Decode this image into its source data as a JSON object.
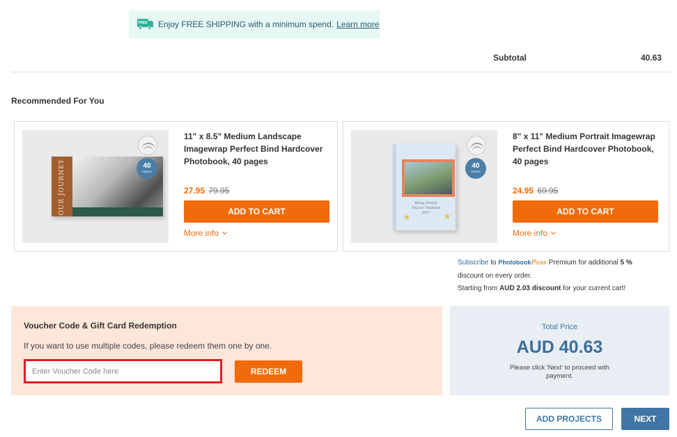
{
  "shipping_banner": {
    "icon": "free-shipping-truck-icon",
    "icon_label": "FREE",
    "text": "Enjoy FREE SHIPPING with a minimum spend.",
    "link": "Learn more"
  },
  "summary": {
    "subtotal_label": "Subtotal",
    "subtotal_value": "40.63"
  },
  "recommended": {
    "title": "Recommended For You",
    "products": [
      {
        "title": "11\" x 8.5\" Medium Landscape Imagewrap Perfect Bind Hardcover Photobook, 40 pages",
        "price": "27.95",
        "old_price": "79.95",
        "add_label": "ADD TO CART",
        "more_info": "More info",
        "badge_number": "40",
        "badge_label": "PAGES",
        "cover_text": "OUR JOURNEY"
      },
      {
        "title": "8\" x 11\" Medium Portrait Imagewrap Perfect Bind Hardcover Photobook, 40 pages",
        "price": "24.95",
        "old_price": "69.95",
        "add_label": "ADD TO CART",
        "more_info": "More info",
        "badge_number": "40",
        "badge_label": "PAGES",
        "cover_line1": "Wong Family",
        "cover_line2": "Trip to Thailand",
        "cover_line3": "2017"
      }
    ]
  },
  "subscription": {
    "subscribe": "Subscribe",
    "to": "to",
    "brand": "Photobook",
    "brand_pass": "Pass",
    "premium_text": "Premium for additional",
    "percent": "5 %",
    "discount_text": "discount on every order.",
    "starting_from": "Starting from",
    "discount_amount": "AUD 2.03 discount",
    "cart_text": "for your current cart!"
  },
  "voucher": {
    "title": "Voucher Code & Gift Card Redemption",
    "description": "If you want to use multiple codes, please redeem them one by one.",
    "placeholder": "Enter Voucher Code here",
    "value": "",
    "redeem_label": "REDEEM"
  },
  "total": {
    "label": "Total Price",
    "value": "AUD 40.63",
    "note": "Please click 'Next' to proceed with payment."
  },
  "actions": {
    "add_projects": "ADD PROJECTS",
    "next": "NEXT"
  },
  "colors": {
    "accent_orange": "#f26b0b",
    "primary_blue": "#3f76a3",
    "voucher_bg": "#fde6da",
    "total_bg": "#e8eef3",
    "banner_bg": "#e6f7f4",
    "highlight_red": "#e51c23"
  }
}
